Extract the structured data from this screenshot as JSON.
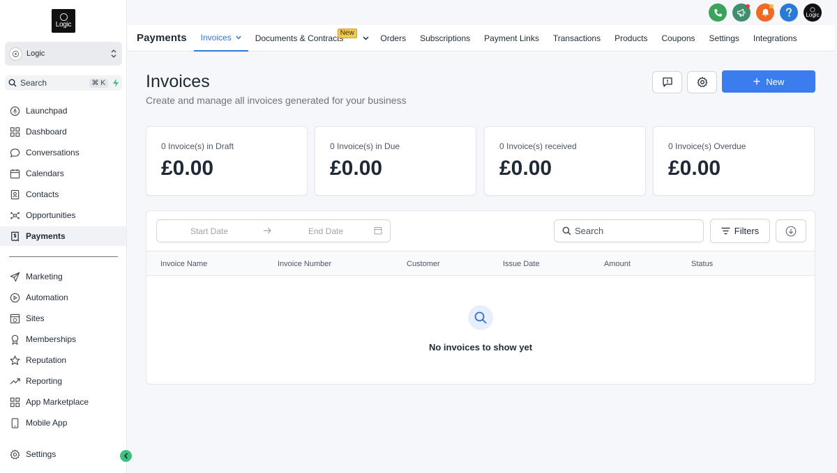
{
  "sidebar": {
    "logo_text": "Logic",
    "account_name": "Logic",
    "search_label": "Search",
    "search_shortcut": "⌘ K",
    "items": [
      {
        "label": "Launchpad",
        "icon": "launchpad-icon"
      },
      {
        "label": "Dashboard",
        "icon": "dashboard-icon"
      },
      {
        "label": "Conversations",
        "icon": "chat-icon"
      },
      {
        "label": "Calendars",
        "icon": "calendar-icon"
      },
      {
        "label": "Contacts",
        "icon": "contacts-icon"
      },
      {
        "label": "Opportunities",
        "icon": "opportunities-icon"
      },
      {
        "label": "Payments",
        "icon": "receipt-icon",
        "active": true
      },
      {
        "label": "Marketing",
        "icon": "send-icon"
      },
      {
        "label": "Automation",
        "icon": "automation-icon"
      },
      {
        "label": "Sites",
        "icon": "sites-icon"
      },
      {
        "label": "Memberships",
        "icon": "badge-icon"
      },
      {
        "label": "Reputation",
        "icon": "star-icon"
      },
      {
        "label": "Reporting",
        "icon": "trend-icon"
      },
      {
        "label": "App Marketplace",
        "icon": "apps-icon"
      },
      {
        "label": "Mobile App",
        "icon": "mobile-icon"
      }
    ],
    "settings_label": "Settings"
  },
  "topbar": {
    "avatar_text": "Logic",
    "colors": {
      "phone": "#3aa35c",
      "megaphone": "#3f8f6e",
      "bell": "#ef6a22",
      "help": "#2a7ad8",
      "badge_dot": "#e23b3b",
      "badge_dot_bell": "#f5b342"
    }
  },
  "nav": {
    "module": "Payments",
    "tabs": [
      "Invoices",
      "Documents & Contracts",
      "Orders",
      "Subscriptions",
      "Payment Links",
      "Transactions",
      "Products",
      "Coupons",
      "Settings",
      "Integrations"
    ],
    "new_badge": "New"
  },
  "page": {
    "title": "Invoices",
    "subtitle": "Create and manage all invoices generated for your business",
    "new_button": "New"
  },
  "stats": [
    {
      "label": "0 Invoice(s) in Draft",
      "value": "£0.00"
    },
    {
      "label": "0 Invoice(s) in Due",
      "value": "£0.00"
    },
    {
      "label": "0 Invoice(s) received",
      "value": "£0.00"
    },
    {
      "label": "0 Invoice(s) Overdue",
      "value": "£0.00"
    }
  ],
  "table": {
    "start_date_placeholder": "Start Date",
    "end_date_placeholder": "End Date",
    "search_placeholder": "Search",
    "filters_label": "Filters",
    "columns": [
      "Invoice Name",
      "Invoice Number",
      "Customer",
      "Issue Date",
      "Amount",
      "Status"
    ],
    "empty_message": "No invoices to show yet"
  },
  "theme": {
    "accent": "#3b7ded",
    "active_tab": "#2a7ad8",
    "collapse": "#3fbf7f"
  }
}
